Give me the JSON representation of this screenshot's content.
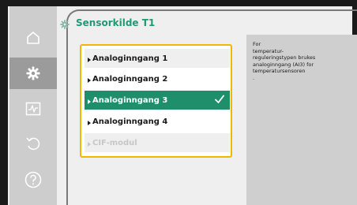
{
  "colors": {
    "accent": "#1e8f6a",
    "title": "#1e9a74",
    "focus_frame": "#f2b705",
    "sidebar": "#cdcdcd",
    "sidebar_active": "#9b9b9b",
    "help_panel": "#cfcfcf"
  },
  "header": {
    "title": "Sensorkilde T1",
    "icon": "gear-icon"
  },
  "sidebar": {
    "items": [
      {
        "icon": "home-icon",
        "active": false
      },
      {
        "icon": "gear-icon",
        "active": true
      },
      {
        "icon": "pulse-monitor-icon",
        "active": false
      },
      {
        "icon": "undo-icon",
        "active": false
      },
      {
        "icon": "help-icon",
        "active": false
      }
    ]
  },
  "options": [
    {
      "label": "Analoginngang 1",
      "selected": false,
      "disabled": false
    },
    {
      "label": "Analoginngang 2",
      "selected": false,
      "disabled": false
    },
    {
      "label": "Analoginngang 3",
      "selected": true,
      "disabled": false
    },
    {
      "label": "Analoginngang 4",
      "selected": false,
      "disabled": false
    },
    {
      "label": "CIF-modul",
      "selected": false,
      "disabled": true
    }
  ],
  "help": {
    "text": "For\ntemperatur-\nreguleringstypen brukes\nanaloginngang (AI3) for\ntemperatursensoren\n."
  }
}
